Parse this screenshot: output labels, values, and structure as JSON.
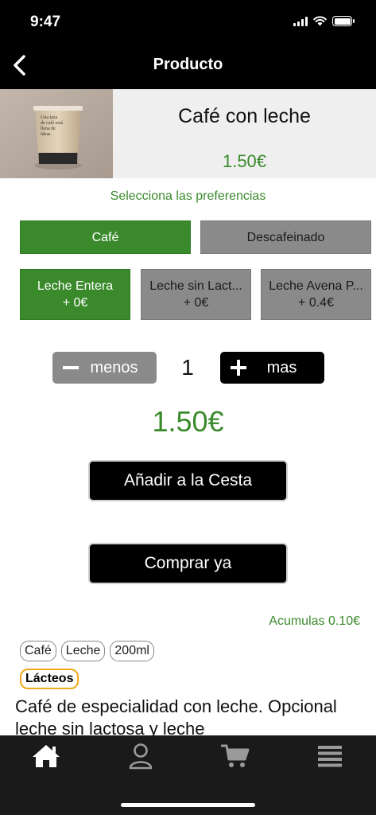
{
  "status_bar": {
    "time": "9:47"
  },
  "nav": {
    "title": "Producto"
  },
  "product": {
    "name": "Café con leche",
    "price": "1.50€",
    "cup_text": "Una taza de café está llena de ideas."
  },
  "preferences": {
    "label": "Selecciona las preferencias",
    "coffee_options": [
      {
        "label": "Café",
        "selected": true
      },
      {
        "label": "Descafeinado",
        "selected": false
      }
    ],
    "milk_options": [
      {
        "label": "Leche Entera",
        "extra": "+ 0€",
        "selected": true
      },
      {
        "label": "Leche sin Lact...",
        "extra": "+ 0€",
        "selected": false
      },
      {
        "label": "Leche Avena P...",
        "extra": "+ 0.4€",
        "selected": false
      }
    ]
  },
  "quantity": {
    "minus_label": "menos",
    "value": "1",
    "plus_label": "mas"
  },
  "total_price": "1.50€",
  "actions": {
    "add_to_cart": "Añadir a la Cesta",
    "buy_now": "Comprar ya"
  },
  "accumulate_text": "Acumulas 0.10€",
  "tags": [
    "Café",
    "Leche",
    "200ml"
  ],
  "allergen_tag": "Lácteos",
  "description": "Café de especialidad con leche. Opcional leche sin lactosa y leche",
  "tab_bar": {
    "tabs": [
      {
        "icon": "home-icon"
      },
      {
        "icon": "user-icon"
      },
      {
        "icon": "cart-icon"
      },
      {
        "icon": "menu-icon"
      }
    ]
  },
  "colors": {
    "accent_green": "#3a8a2c",
    "unselected_gray": "#8a8a8a",
    "allergen_border": "#f0a91a"
  }
}
